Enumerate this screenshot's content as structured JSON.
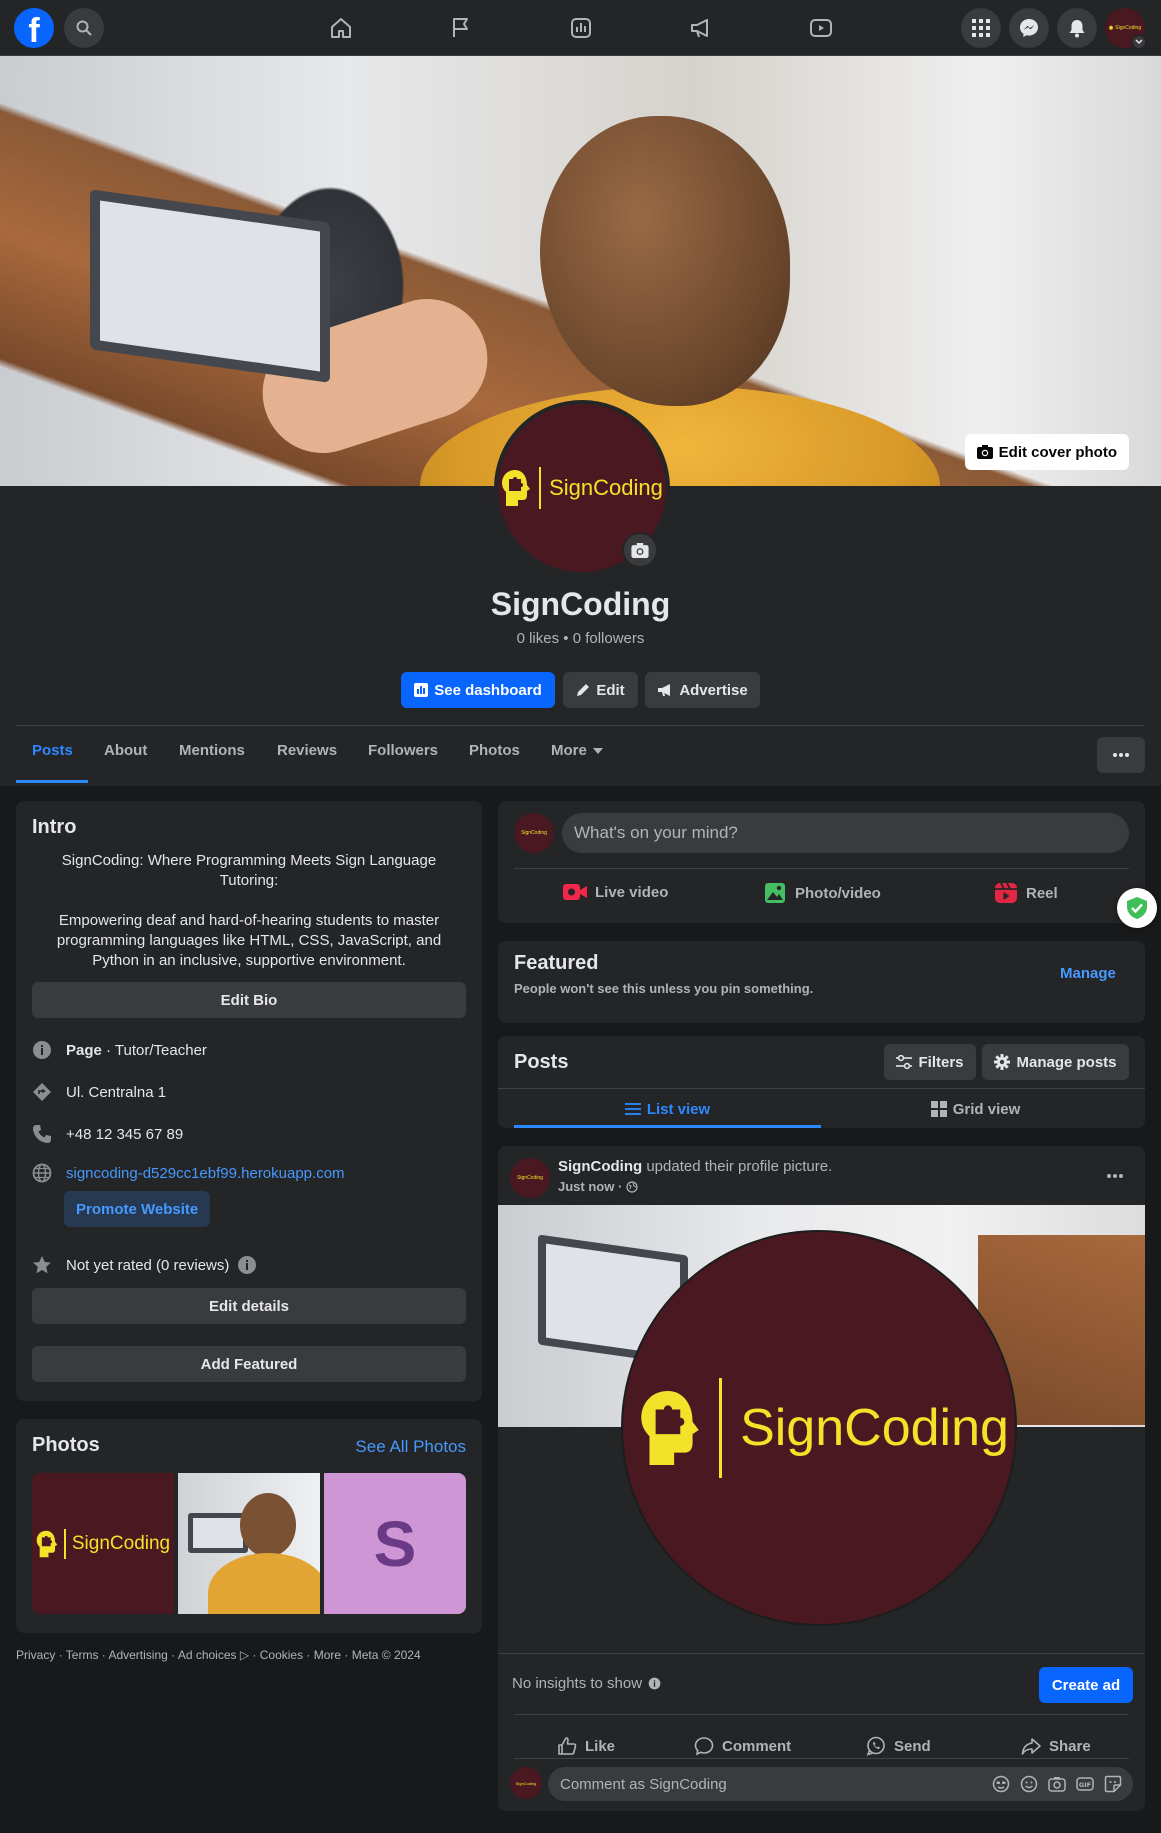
{
  "nav": {
    "brand_icon": "facebook-logo",
    "search_icon": "search-icon",
    "center_icons": [
      "home-icon",
      "flag-icon",
      "insights-icon",
      "megaphone-icon",
      "video-icon"
    ],
    "right_icons": [
      "menu-grid-icon",
      "messenger-icon",
      "bell-icon",
      "avatar"
    ]
  },
  "cover": {
    "edit_label": "Edit cover photo"
  },
  "profile": {
    "name": "SignCoding",
    "stats": "0 likes • 0 followers",
    "logo_text": "SignCoding",
    "actions": {
      "dashboard": "See dashboard",
      "edit": "Edit",
      "advertise": "Advertise"
    }
  },
  "tabs": [
    "Posts",
    "About",
    "Mentions",
    "Reviews",
    "Followers",
    "Photos",
    "More"
  ],
  "intro": {
    "title": "Intro",
    "bio_line1": "SignCoding: Where Programming Meets Sign Language Tutoring:",
    "bio_line2": "Empowering deaf and hard-of-hearing students to master programming languages like HTML, CSS, JavaScript, and Python in an inclusive, supportive environment.",
    "edit_bio": "Edit Bio",
    "page_label": "Page",
    "page_category": " · Tutor/Teacher",
    "address": "Ul. Centralna 1",
    "phone": "+48 12 345 67 89",
    "website": "signcoding-d529cc1ebf99.herokuapp.com",
    "promote": "Promote Website",
    "rating": "Not yet rated (0 reviews)",
    "edit_details": "Edit details",
    "add_featured": "Add Featured"
  },
  "photos": {
    "title": "Photos",
    "see_all": "See All Photos",
    "tile3_letter": "S"
  },
  "footer": "Privacy · Terms · Advertising · Ad choices ▷ · Cookies · More · Meta © 2024",
  "composer": {
    "placeholder": "What's on your mind?",
    "live": "Live video",
    "photo": "Photo/video",
    "reel": "Reel"
  },
  "featured": {
    "title": "Featured",
    "subtitle": "People won't see this unless you pin something.",
    "manage": "Manage"
  },
  "posts_header": {
    "title": "Posts",
    "filters": "Filters",
    "manage_posts": "Manage posts",
    "list_view": "List view",
    "grid_view": "Grid view"
  },
  "post": {
    "author": "SignCoding",
    "action": " updated their profile picture.",
    "time": "Just now ·",
    "logo_text": "SignCoding",
    "insights": "No insights to show",
    "create_ad": "Create ad",
    "like": "Like",
    "comment": "Comment",
    "send": "Send",
    "share": "Share",
    "comment_placeholder": "Comment as SignCoding"
  },
  "colors": {
    "accent": "#0866ff",
    "logo_bg": "#4a1820",
    "logo_fg": "#f2e22a"
  }
}
